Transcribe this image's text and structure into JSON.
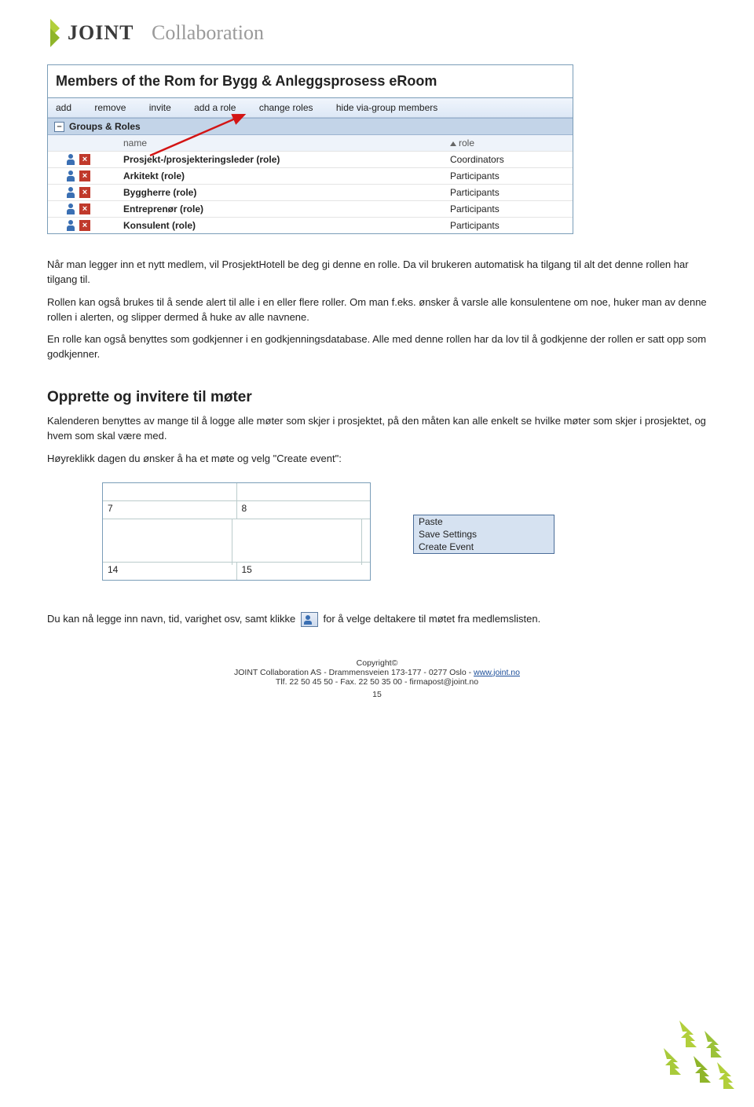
{
  "logo": {
    "word1": "JOINT",
    "word2": "Collaboration"
  },
  "members_window": {
    "title": "Members of the Rom for Bygg & Anleggsprosess eRoom",
    "toolbar": [
      "add",
      "remove",
      "invite",
      "add a role",
      "change roles",
      "hide via-group members"
    ],
    "section_label": "Groups & Roles",
    "header_name": "name",
    "header_role": "role",
    "rows": [
      {
        "name": "Prosjekt-/prosjekteringsleder (role)",
        "role": "Coordinators"
      },
      {
        "name": "Arkitekt (role)",
        "role": "Participants"
      },
      {
        "name": "Byggherre (role)",
        "role": "Participants"
      },
      {
        "name": "Entreprenør (role)",
        "role": "Participants"
      },
      {
        "name": "Konsulent (role)",
        "role": "Participants"
      }
    ]
  },
  "paragraphs": {
    "p1": "Når man legger inn et nytt medlem, vil ProsjektHotell be deg gi denne en rolle. Da vil brukeren automatisk ha tilgang til alt det denne rollen har tilgang til.",
    "p2": "Rollen kan også brukes til å sende alert til alle i en eller flere roller. Om man f.eks. ønsker å varsle alle konsulentene om noe, huker man av denne rollen i alerten, og slipper dermed å huke av alle navnene.",
    "p3": "En rolle kan også benyttes som godkjenner i en godkjenningsdatabase. Alle med denne rollen har da lov til å godkjenne der rollen er satt opp som godkjenner."
  },
  "section2": {
    "heading": "Opprette og invitere til møter",
    "p1": "Kalenderen benyttes av mange til å logge alle møter som skjer i prosjektet, på den måten kan alle enkelt se hvilke møter som skjer i prosjektet, og hvem som skal være med.",
    "p2": "Høyreklikk dagen du ønsker å ha et møte og velg \"Create event\":"
  },
  "calendar": {
    "days_top": [
      "7",
      "8"
    ],
    "menu": [
      "Paste",
      "Save Settings",
      "Create Event"
    ],
    "days_bottom": [
      "14",
      "15"
    ]
  },
  "final": {
    "pre": "Du kan nå legge inn navn, tid, varighet osv, samt klikke ",
    "post": " for å velge deltakere til møtet fra medlemslisten."
  },
  "footer": {
    "copyright": "Copyright©",
    "line2a": "JOINT Collaboration AS - Drammensveien 173-177 - 0277 Oslo - ",
    "link": "www.joint.no",
    "line3": "Tlf. 22 50 45 50 - Fax. 22 50 35 00 - firmapost@joint.no",
    "page": "15"
  }
}
